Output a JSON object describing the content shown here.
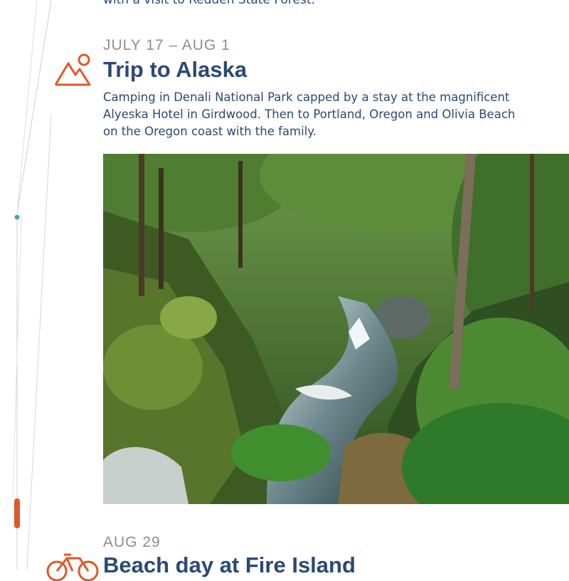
{
  "previous_entry": {
    "text_fragment": "with a visit to Redden State Forest."
  },
  "entries": [
    {
      "date": "JULY 17 – AUG 1",
      "title": "Trip to Alaska",
      "description": "Camping in Denali National Park capped by a stay at the magnificent Alyeska Hotel in Girdwood. Then to Portland, Oregon and Olivia Beach on the Oregon coast with the family.",
      "icon": "mountain-sun-icon",
      "image": "forest-river-gorge-photo"
    },
    {
      "date": "AUG 29",
      "title": "Beach day at Fire Island",
      "icon": "bicycle-icon"
    }
  ],
  "colors": {
    "accent": "#e2572b",
    "title": "#2a4a73",
    "date": "#8f8c94",
    "timeline_dot": "#4aa3b5",
    "timeline_line": "#c8c8c8"
  }
}
